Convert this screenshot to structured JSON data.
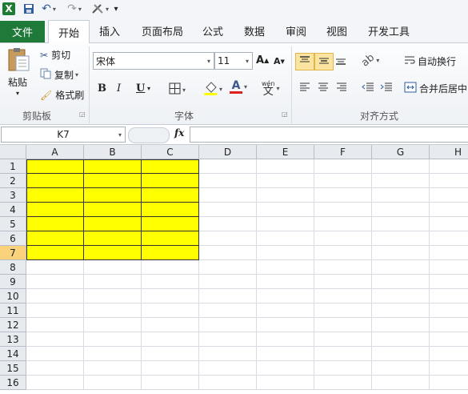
{
  "ribbon_tabs": {
    "file": "文件",
    "home": "开始",
    "insert": "插入",
    "page_layout": "页面布局",
    "formulas": "公式",
    "data": "数据",
    "review": "审阅",
    "view": "视图",
    "developer": "开发工具"
  },
  "clipboard": {
    "paste": "粘贴",
    "cut": "剪切",
    "copy": "复制",
    "format_painter": "格式刷",
    "group_label": "剪贴板"
  },
  "font": {
    "name": "宋体",
    "size": "11",
    "bold": "B",
    "italic": "I",
    "underline": "U",
    "group_label": "字体"
  },
  "alignment": {
    "wrap_text": "自动换行",
    "merge_center": "合并后居中",
    "group_label": "对齐方式"
  },
  "formula_bar": {
    "name_box": "K7",
    "fx": "fx"
  },
  "grid": {
    "columns": [
      "A",
      "B",
      "C",
      "D",
      "E",
      "F",
      "G",
      "H"
    ],
    "rows": [
      "1",
      "2",
      "3",
      "4",
      "5",
      "6",
      "7",
      "8",
      "9",
      "10",
      "11",
      "12",
      "13",
      "14",
      "15",
      "16"
    ],
    "selected_row": "7",
    "highlight_color": "#ffff00"
  }
}
